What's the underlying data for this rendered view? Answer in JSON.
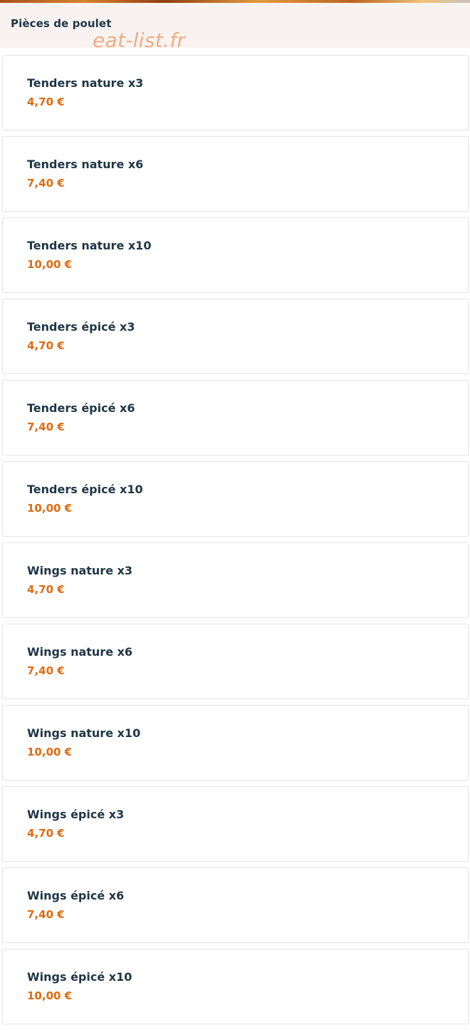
{
  "category": {
    "title": "Pièces de poulet"
  },
  "watermark": "eat-list.fr",
  "colors": {
    "header_bg": "#f8f3f0",
    "title_text": "#1f3645",
    "price_text": "#e06b10",
    "card_border": "#e6e6e6"
  },
  "items": [
    {
      "name": "Tenders nature x3",
      "price": "4,70 €"
    },
    {
      "name": "Tenders nature x6",
      "price": "7,40 €"
    },
    {
      "name": "Tenders nature x10",
      "price": "10,00 €"
    },
    {
      "name": "Tenders épicé x3",
      "price": "4,70 €"
    },
    {
      "name": "Tenders épicé x6",
      "price": "7,40 €"
    },
    {
      "name": "Tenders épicé x10",
      "price": "10,00 €"
    },
    {
      "name": "Wings nature x3",
      "price": "4,70 €"
    },
    {
      "name": "Wings nature x6",
      "price": "7,40 €"
    },
    {
      "name": "Wings nature x10",
      "price": "10,00 €"
    },
    {
      "name": "Wings épicé x3",
      "price": "4,70 €"
    },
    {
      "name": "Wings épicé x6",
      "price": "7,40 €"
    },
    {
      "name": "Wings épicé x10",
      "price": "10,00 €"
    }
  ]
}
